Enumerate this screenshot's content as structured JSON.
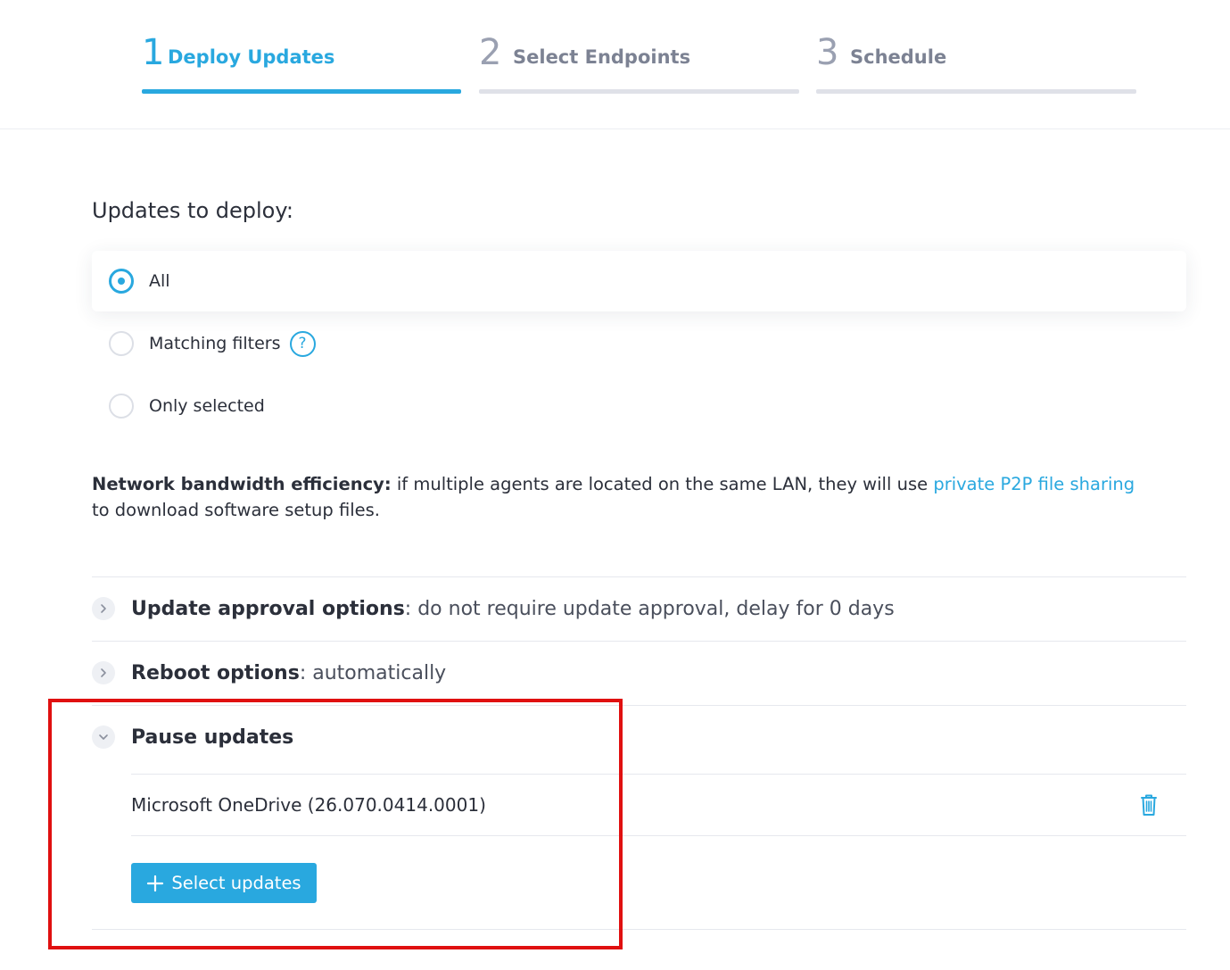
{
  "stepper": {
    "steps": [
      {
        "number": "1",
        "label": "Deploy Updates",
        "active": true
      },
      {
        "number": "2",
        "label": "Select Endpoints",
        "active": false
      },
      {
        "number": "3",
        "label": "Schedule",
        "active": false
      }
    ]
  },
  "updates_to_deploy": {
    "title": "Updates to deploy:",
    "options": [
      {
        "label": "All",
        "selected": true
      },
      {
        "label": "Matching filters",
        "selected": false,
        "help_icon": "question-icon",
        "help_glyph": "?"
      },
      {
        "label": "Only selected",
        "selected": false
      }
    ]
  },
  "bandwidth": {
    "bold": "Network bandwidth efficiency:",
    "text_before_link": " if multiple agents are located on the same LAN, they will use ",
    "link": "private P2P file sharing",
    "text_after_link": " to download software setup files."
  },
  "accordion": {
    "approval": {
      "key": "Update approval options",
      "value": ": do not require update approval, delay for 0 days",
      "expanded": false,
      "icon": "chevron-right-icon"
    },
    "reboot": {
      "key": "Reboot options",
      "value": ": automatically",
      "expanded": false,
      "icon": "chevron-right-icon"
    },
    "pause": {
      "title": "Pause updates",
      "expanded": true,
      "icon": "chevron-down-icon",
      "items": [
        {
          "name": "Microsoft OneDrive (26.070.0414.0001)",
          "action_icon": "trash-icon"
        }
      ],
      "select_button": "Select updates"
    }
  },
  "colors": {
    "accent": "#29a8df",
    "highlight": "#e01010",
    "text": "#2b2f3a"
  }
}
